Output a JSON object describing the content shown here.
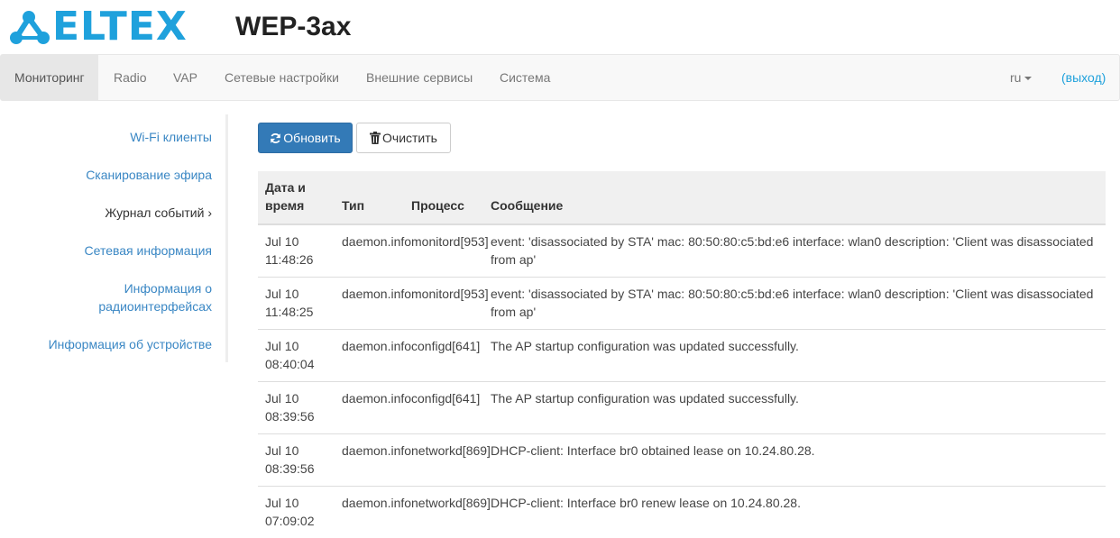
{
  "header": {
    "logo_text": "ELTEX",
    "device_title": "WEP-3ax"
  },
  "navbar": {
    "items": [
      {
        "label": "Мониторинг",
        "active": true
      },
      {
        "label": "Radio"
      },
      {
        "label": "VAP"
      },
      {
        "label": "Сетевые настройки"
      },
      {
        "label": "Внешние сервисы"
      },
      {
        "label": "Система"
      }
    ],
    "language": "ru",
    "logout": "(выход)"
  },
  "sidebar": {
    "items": [
      {
        "label": "Wi-Fi клиенты"
      },
      {
        "label": "Сканирование эфира"
      },
      {
        "label": "Журнал событий ›",
        "current": true
      },
      {
        "label": "Сетевая информация"
      },
      {
        "label": "Информация о радиоинтерфейсах"
      },
      {
        "label": "Информация об устройстве"
      }
    ]
  },
  "toolbar": {
    "refresh_label": "Обновить",
    "clear_label": "Очистить"
  },
  "table": {
    "headers": {
      "date": "Дата и время",
      "type": "Тип",
      "process": "Процесс",
      "message": "Сообщение"
    },
    "rows": [
      {
        "date": "Jul 10 11:48:26",
        "type": "daemon.info",
        "process": "monitord[953]",
        "message": "event: 'disassociated by STA' mac: 80:50:80:c5:bd:e6 interface: wlan0 description: 'Client was disassociated from ap'"
      },
      {
        "date": "Jul 10 11:48:25",
        "type": "daemon.info",
        "process": "monitord[953]",
        "message": "event: 'disassociated by STA' mac: 80:50:80:c5:bd:e6 interface: wlan0 description: 'Client was disassociated from ap'"
      },
      {
        "date": "Jul 10 08:40:04",
        "type": "daemon.info",
        "process": "configd[641]",
        "message": "The AP startup configuration was updated successfully."
      },
      {
        "date": "Jul 10 08:39:56",
        "type": "daemon.info",
        "process": "configd[641]",
        "message": "The AP startup configuration was updated successfully."
      },
      {
        "date": "Jul 10 08:39:56",
        "type": "daemon.info",
        "process": "networkd[869]",
        "message": "DHCP-client: Interface br0 obtained lease on 10.24.80.28."
      },
      {
        "date": "Jul 10 07:09:02",
        "type": "daemon.info",
        "process": "networkd[869]",
        "message": "DHCP-client: Interface br0 renew lease on 10.24.80.28."
      }
    ]
  },
  "colors": {
    "brand": "#1fa1dc",
    "primary_button": "#337ab7",
    "link": "#3a87c4"
  }
}
